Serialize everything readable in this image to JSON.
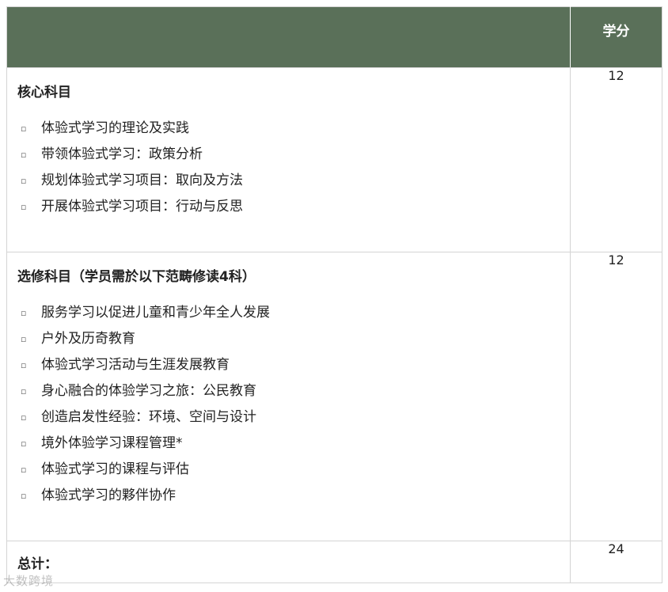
{
  "header": {
    "col1": "",
    "col2": "学分"
  },
  "core": {
    "title": "核心科目",
    "items": [
      "体验式学习的理论及实践",
      "带领体验式学习：政策分析",
      "规划体验式学习项目：取向及方法",
      "开展体验式学习项目：行动与反思"
    ],
    "credits": "12"
  },
  "elective": {
    "title": "选修科目（学员需於以下范畴修读4科）",
    "items": [
      "服务学习以促进儿童和青少年全人发展",
      "户外及历奇教育",
      "体验式学习活动与生涯发展教育",
      "身心融合的体验学习之旅：公民教育",
      "创造启发性经验：环境、空间与设计",
      "境外体验学习课程管理*",
      "体验式学习的课程与评估",
      "体验式学习的夥伴协作"
    ],
    "credits": "12"
  },
  "total": {
    "label": "总计：",
    "credits": "24"
  },
  "watermark": "大数跨境",
  "bullet_glyph": "▫"
}
